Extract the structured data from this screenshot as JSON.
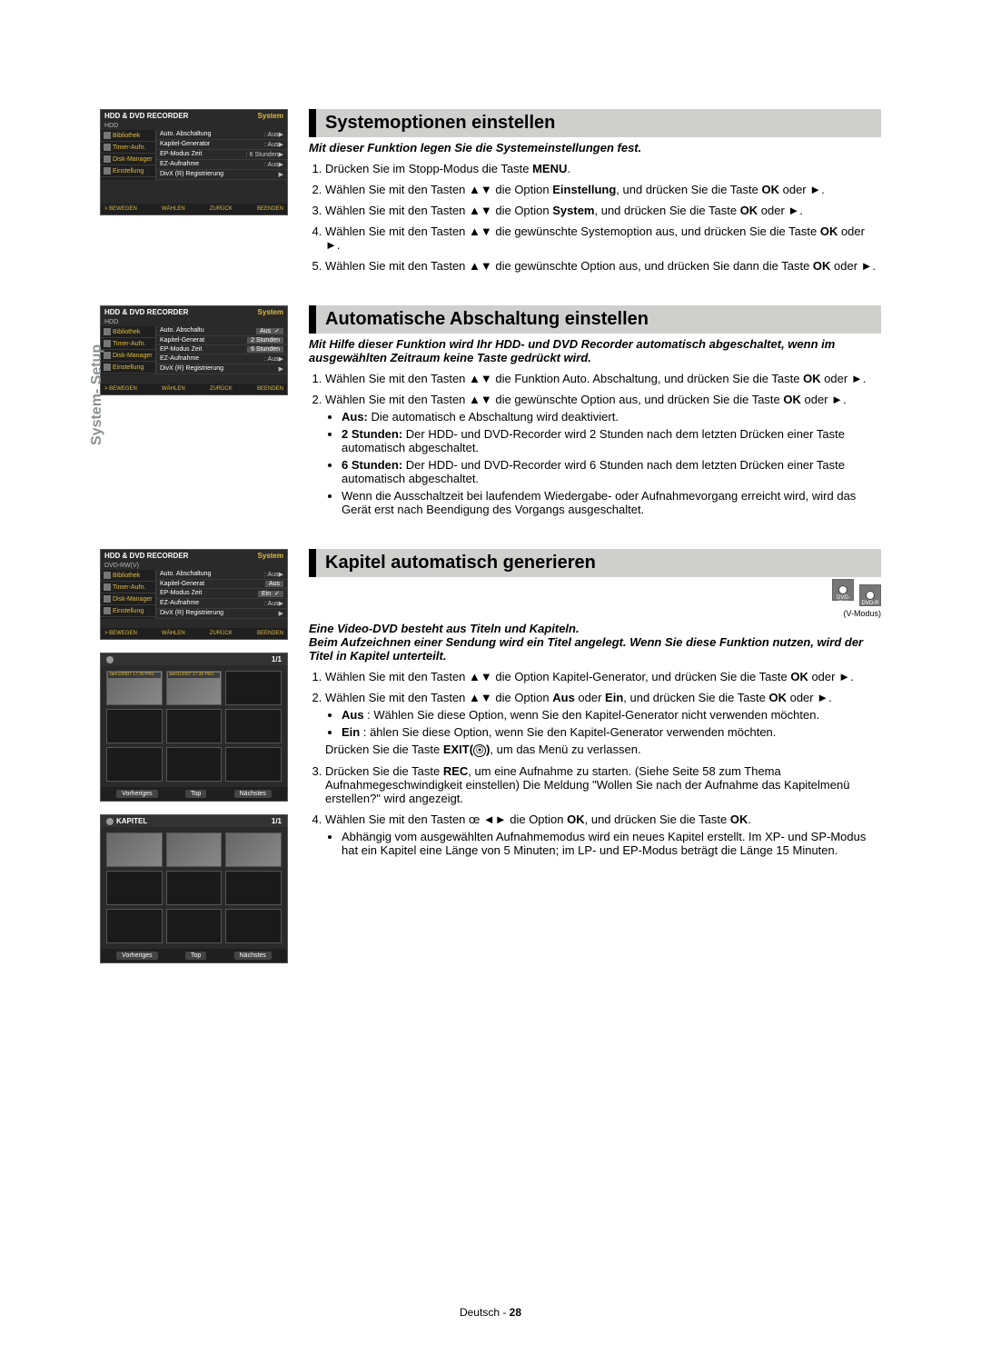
{
  "sideTab": "System- Setup",
  "footer": {
    "lang": "Deutsch",
    "page": "28"
  },
  "osd": {
    "title": "HDD & DVD RECORDER",
    "titleRight": "System",
    "sub1": "HDD",
    "sub3": "DVD-RW(V)",
    "nav": [
      "Bibliothek",
      "Timer-Aufn.",
      "Disk-Manager",
      "Einstellung"
    ],
    "footerBtns": [
      "> BEWEGEN",
      "WÄHLEN",
      "ZURÜCK",
      "BEENDEN"
    ],
    "settings1": [
      {
        "k": "Auto. Abschaltung",
        "v": ": Aus",
        "arrow": true
      },
      {
        "k": "Kapitel-Generator",
        "v": ": Aus",
        "arrow": true
      },
      {
        "k": "EP-Modus Zeit",
        "v": ": 6 Stunden",
        "arrow": true
      },
      {
        "k": "EZ-Aufnahme",
        "v": ": Aus",
        "arrow": true
      },
      {
        "k": "DivX (R) Registrierung",
        "v": "",
        "arrow": true
      }
    ],
    "settings2": [
      {
        "k": "Auto. Abschaltu",
        "drop": "Aus",
        "check": true
      },
      {
        "k": "Kapitel-Generat",
        "drop": "2 Stunden"
      },
      {
        "k": "EP-Modus Zeit",
        "drop": "6 Stunden"
      },
      {
        "k": "EZ-Aufnahme",
        "v": ": Aus",
        "arrow": true
      },
      {
        "k": "DivX (R) Registrierung",
        "v": "",
        "arrow": true
      }
    ],
    "settings3": [
      {
        "k": "Auto. Abschaltung",
        "v": ": Aus",
        "arrow": true
      },
      {
        "k": "Kapitel-Generat",
        "drop": "Aus"
      },
      {
        "k": "EP-Modus Zeit",
        "drop": "Ein",
        "check": true
      },
      {
        "k": "EZ-Aufnahme",
        "v": ": Aus",
        "arrow": true
      },
      {
        "k": "DivX (R) Registrierung",
        "v": "",
        "arrow": true
      }
    ]
  },
  "thumbs": {
    "header1_left": "",
    "header1_right": "1/1",
    "header2_left": "KAPITEL",
    "header2_right": "1/1",
    "cell_caption": "Jan/1/2007\n17:30 PR1",
    "buttons": [
      "Vorheriges",
      "Top",
      "Nächstes"
    ]
  },
  "disc": {
    "l1": "DVD-RW",
    "l2": "DVD-R",
    "caption": "(V-Modus)"
  },
  "sec1": {
    "title": "Systemoptionen einstellen",
    "intro": "Mit dieser Funktion legen Sie die Systemeinstellungen fest.",
    "steps": [
      "Drücken Sie im Stopp-Modus die Taste <b>MENU</b>.",
      "Wählen Sie mit den Tasten ▲▼ die Option <b>Einstellung</b>, und drücken Sie die Taste <b>OK</b> oder ►.",
      "Wählen Sie mit den Tasten ▲▼ die Option <b>System</b>, und drücken Sie die Taste <b>OK</b> oder ►.",
      "Wählen Sie mit den Tasten ▲▼ die gewünschte Systemoption aus, und drücken Sie die Taste <b>OK</b> oder ►.",
      "Wählen Sie mit den Tasten ▲▼ die gewünschte Option aus, und drücken Sie dann die Taste <b>OK</b> oder ►."
    ]
  },
  "sec2": {
    "title": "Automatische Abschaltung einstellen",
    "intro": "Mit Hilfe dieser Funktion wird Ihr HDD- und DVD Recorder automatisch abgeschaltet, wenn im ausgewählten Zeitraum keine Taste gedrückt wird.",
    "steps": [
      "Wählen Sie mit den Tasten ▲▼ die Funktion Auto. Abschaltung, und drücken Sie die Taste <b>OK</b> oder ►.",
      "Wählen Sie mit den Tasten ▲▼ die gewünschte Option aus, und drücken Sie die Taste <b>OK</b> oder ►."
    ],
    "bullets": [
      "<b>Aus:</b> Die automatisch e Abschaltung wird deaktiviert.",
      "<b>2 Stunden:</b> Der HDD- und DVD-Recorder wird 2 Stunden nach dem letzten Drücken einer Taste automatisch abgeschaltet.",
      "<b>6 Stunden:</b> Der HDD- und DVD-Recorder wird 6 Stunden nach dem letzten Drücken einer Taste automatisch abgeschaltet.",
      "Wenn die Ausschaltzeit bei laufendem Wiedergabe- oder Aufnahmevorgang erreicht wird, wird das Gerät erst nach Beendigung des Vorgangs ausgeschaltet."
    ]
  },
  "sec3": {
    "title": "Kapitel automatisch generieren",
    "intro": "Eine Video-DVD besteht aus Titeln und Kapiteln.<br>Beim Aufzeichnen einer Sendung wird ein Titel angelegt. Wenn Sie diese Funktion nutzen, wird der Titel in Kapitel unterteilt.",
    "steps12": [
      "Wählen Sie mit den Tasten ▲▼ die Option Kapitel-Generator, und drücken Sie die Taste <b>OK</b> oder ►.",
      "Wählen Sie mit den Tasten ▲▼ die Option <b>Aus</b> oder <b>Ein</b>, und drücken Sie die Taste <b>OK</b> oder ►."
    ],
    "bullets2": [
      "<b>Aus</b> : Wählen Sie diese Option, wenn Sie den Kapitel-Generator nicht verwenden möchten.",
      "<b>Ein</b> : ählen Sie diese Option, wenn Sie den Kapitel-Generator verwenden möchten."
    ],
    "afterBullets": "Drücken Sie die Taste <b>EXIT(<span class='play-btn'>⦿</span>)</b>, um das Menü zu verlassen.",
    "step3": "Drücken Sie die Taste <b>REC</b>, um eine Aufnahme zu starten. (Siehe Seite 58 zum Thema Aufnahmegeschwindigkeit einstellen) Die Meldung \"Wollen Sie nach der Aufnahme das Kapitelmenü erstellen?\" wird angezeigt.",
    "step4": "Wählen Sie mit den Tasten œ ◄► die Option <b>OK</b>, und drücken Sie die Taste <b>OK</b>.",
    "step4bullet": "Abhängig vom ausgewählten Aufnahmemodus wird ein neues Kapitel erstellt. Im XP- und SP-Modus hat ein Kapitel eine Länge von 5 Minuten; im LP- und EP-Modus beträgt die Länge 15 Minuten."
  }
}
